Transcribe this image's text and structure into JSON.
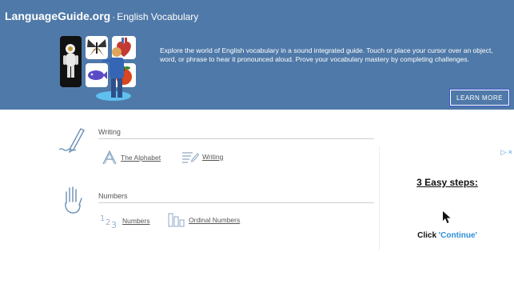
{
  "header": {
    "site_name": "LanguageGuide.org",
    "separator": "·",
    "subtitle": "English Vocabulary",
    "intro": "Explore the world of English vocabulary in a sound integrated guide. Touch or place your cursor over an object, word, or phrase to hear it pronounced aloud. Prove your vocabulary mastery by completing challenges.",
    "learn_more_label": "LEARN MORE",
    "brand_color": "#4f79a8"
  },
  "sections": [
    {
      "title": "Writing",
      "icon": "pencil-icon",
      "items": [
        {
          "label": "The Alphabet",
          "icon": "letter-a-icon"
        },
        {
          "label": "Writing",
          "icon": "writing-lines-icon"
        }
      ]
    },
    {
      "title": "Numbers",
      "icon": "counting-hand-icon",
      "items": [
        {
          "label": "Numbers",
          "icon": "digits-123-icon"
        },
        {
          "label": "Ordinal Numbers",
          "icon": "ordinal-bars-icon"
        }
      ]
    }
  ],
  "ad": {
    "choices_label": "▷ ×",
    "heading": "3 Easy steps:",
    "cta_prefix": "Click ",
    "cta_highlight": "'Continue'",
    "accent_color": "#2a8fd6"
  }
}
